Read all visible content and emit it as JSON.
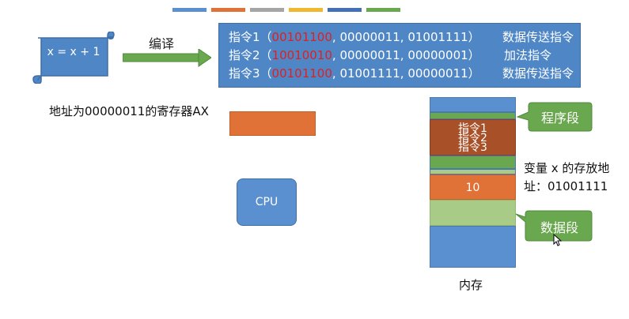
{
  "colors": {
    "top_bars": [
      "#5b8fd0",
      "#e07238",
      "#a5a5a5",
      "#f0b830",
      "#4470b8",
      "#6aa84f"
    ],
    "instr_box": "#4f86c6",
    "highlight_red": "#e02020",
    "register_ax": "#e07238",
    "cpu": "#5a8fd0",
    "program_segment": "#a85028",
    "data_segment": "#a8cc88",
    "callout_green": "#6aa84f"
  },
  "source": {
    "expression": "x = x + 1"
  },
  "compile": {
    "label": "编译"
  },
  "instructions": [
    {
      "name": "指令1（",
      "opcode": "00101100",
      "operands": ", 00000011, 01001111）",
      "desc": "数据传送指令"
    },
    {
      "name": "指令2（",
      "opcode": "10010010",
      "operands": ", 00000011, 00000001）",
      "desc": "加法指令"
    },
    {
      "name": "指令3（",
      "opcode": "00101100",
      "operands": ", 01001111, 00000011）",
      "desc": "数据传送指令"
    }
  ],
  "register": {
    "label": "地址为00000011的寄存器AX"
  },
  "cpu": {
    "label": "CPU"
  },
  "memory": {
    "label": "内存",
    "instr_lines": [
      "指令1",
      "指令2",
      "指令3"
    ],
    "value": "10"
  },
  "callouts": {
    "program": "程序段",
    "data": "数据段"
  },
  "variable": {
    "line1": "变量 x 的存放地",
    "line2": "址：01001111"
  }
}
